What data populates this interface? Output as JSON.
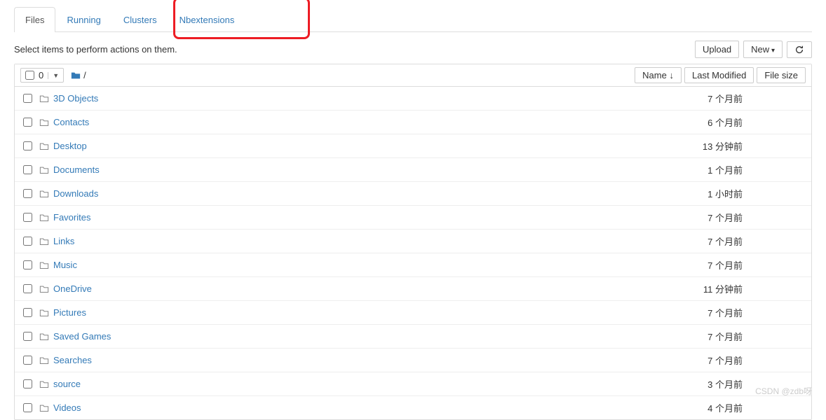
{
  "tabs": [
    {
      "label": "Files",
      "active": true
    },
    {
      "label": "Running",
      "active": false
    },
    {
      "label": "Clusters",
      "active": false
    },
    {
      "label": "Nbextensions",
      "active": false
    }
  ],
  "toolbar": {
    "select_text": "Select items to perform actions on them.",
    "upload_label": "Upload",
    "new_label": "New",
    "refresh_title": "Refresh"
  },
  "list_header": {
    "selected_count": "0",
    "breadcrumb_root": "/",
    "name_col": "Name",
    "modified_col": "Last Modified",
    "size_col": "File size",
    "sort_direction": "down"
  },
  "items": [
    {
      "name": "3D Objects",
      "modified": "7 个月前",
      "size": ""
    },
    {
      "name": "Contacts",
      "modified": "6 个月前",
      "size": ""
    },
    {
      "name": "Desktop",
      "modified": "13 分钟前",
      "size": ""
    },
    {
      "name": "Documents",
      "modified": "1 个月前",
      "size": ""
    },
    {
      "name": "Downloads",
      "modified": "1 小时前",
      "size": ""
    },
    {
      "name": "Favorites",
      "modified": "7 个月前",
      "size": ""
    },
    {
      "name": "Links",
      "modified": "7 个月前",
      "size": ""
    },
    {
      "name": "Music",
      "modified": "7 个月前",
      "size": ""
    },
    {
      "name": "OneDrive",
      "modified": "11 分钟前",
      "size": ""
    },
    {
      "name": "Pictures",
      "modified": "7 个月前",
      "size": ""
    },
    {
      "name": "Saved Games",
      "modified": "7 个月前",
      "size": ""
    },
    {
      "name": "Searches",
      "modified": "7 个月前",
      "size": ""
    },
    {
      "name": "source",
      "modified": "3 个月前",
      "size": ""
    },
    {
      "name": "Videos",
      "modified": "4 个月前",
      "size": ""
    }
  ],
  "watermark": "CSDN @zdb呀"
}
